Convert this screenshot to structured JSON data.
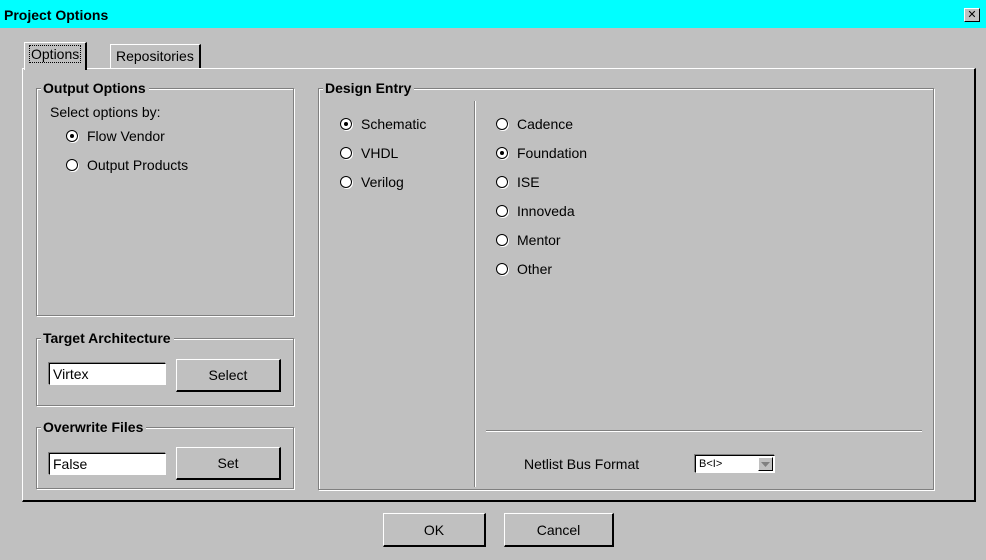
{
  "window": {
    "title": "Project Options",
    "close_glyph": "✕",
    "close_icon": "close-icon"
  },
  "tabs": [
    {
      "label": "Options",
      "active": true
    },
    {
      "label": "Repositories",
      "active": false
    }
  ],
  "output_options": {
    "title": "Output Options",
    "prompt": "Select options by:",
    "options": [
      {
        "label": "Flow Vendor",
        "selected": true
      },
      {
        "label": "Output Products",
        "selected": false
      }
    ]
  },
  "target_architecture": {
    "title": "Target Architecture",
    "value": "Virtex",
    "button_label": "Select"
  },
  "overwrite_files": {
    "title": "Overwrite Files",
    "value": "False",
    "button_label": "Set"
  },
  "design_entry": {
    "title": "Design Entry",
    "languages": [
      {
        "label": "Schematic",
        "selected": true
      },
      {
        "label": "VHDL",
        "selected": false
      },
      {
        "label": "Verilog",
        "selected": false
      }
    ],
    "vendors": [
      {
        "label": "Cadence",
        "selected": false
      },
      {
        "label": "Foundation",
        "selected": true
      },
      {
        "label": "ISE",
        "selected": false
      },
      {
        "label": "Innoveda",
        "selected": false
      },
      {
        "label": "Mentor",
        "selected": false
      },
      {
        "label": "Other",
        "selected": false
      }
    ],
    "netlist_bus_format": {
      "label": "Netlist Bus Format",
      "value": "B<I>",
      "arrow_icon": "chevron-down-icon"
    }
  },
  "buttons": {
    "ok": "OK",
    "cancel": "Cancel"
  },
  "colors": {
    "title_bar": "#00ffff",
    "face": "#c0c0c0"
  }
}
